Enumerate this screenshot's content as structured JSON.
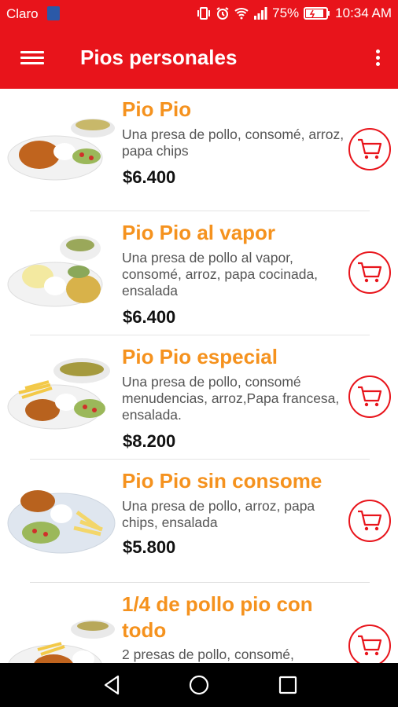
{
  "status_bar": {
    "carrier": "Claro",
    "battery": "75%",
    "time": "10:34 AM"
  },
  "app_bar": {
    "title": "Pios personales"
  },
  "colors": {
    "brand_red": "#e8141b",
    "name_orange": "#f5921e"
  },
  "menu_items": [
    {
      "name": "Pio Pio",
      "description": "Una presa de pollo, consomé, arroz, papa chips",
      "price": "$6.400"
    },
    {
      "name": "Pio Pio al vapor",
      "description": "Una presa de pollo al vapor, consomé, arroz, papa cocinada, ensalada",
      "price": "$6.400"
    },
    {
      "name": "Pio Pio especial",
      "description": "Una presa de pollo, consomé menudencias, arroz,Papa francesa, ensalada.",
      "price": "$8.200"
    },
    {
      "name": "Pio Pio sin consome",
      "description": "Una presa de pollo, arroz, papa chips, ensalada",
      "price": "$5.800"
    },
    {
      "name": "1/4 de pollo pio con todo",
      "description": "2 presas de pollo, consomé,",
      "price": ""
    }
  ],
  "icons": {
    "menu": "hamburger-icon",
    "overflow": "more-vert-icon",
    "cart": "shopping-cart-icon",
    "back": "back-icon",
    "home": "home-icon",
    "recents": "recents-icon"
  }
}
